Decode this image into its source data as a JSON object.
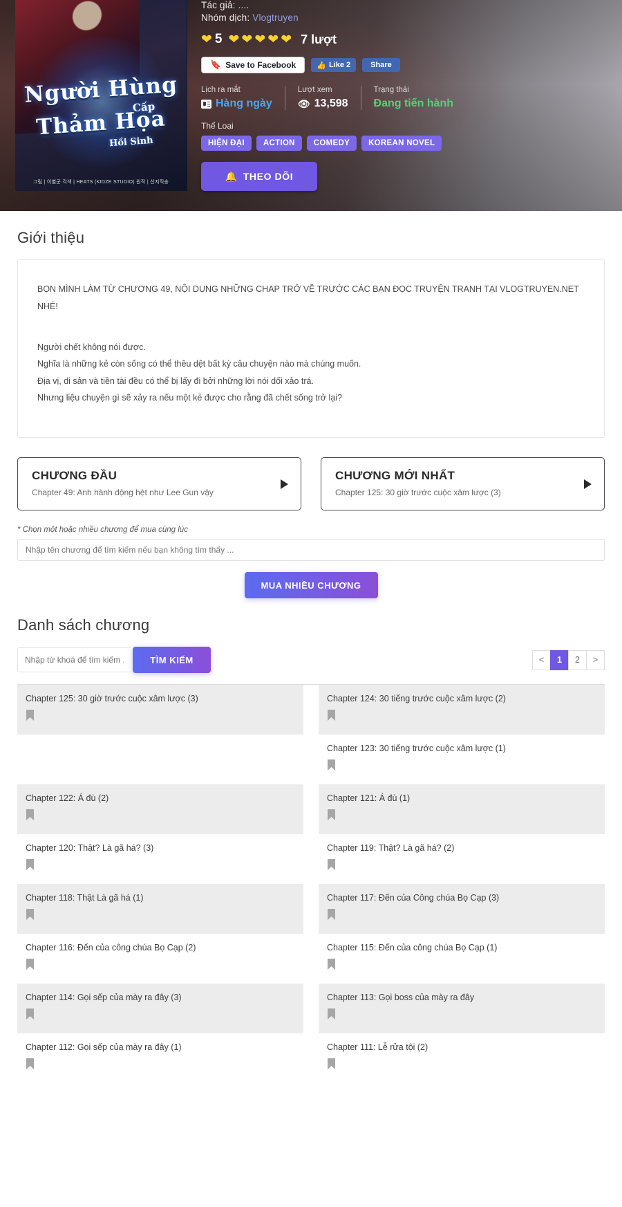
{
  "hero": {
    "cover": {
      "title_line1": "Người Hùng",
      "title_line2": "Thảm Họa",
      "title_small": "Cấp",
      "title_small2": "Hồi Sinh",
      "credits": "그림 | 이별군    각색 | HEATS (KIDZE STUDIO)    원작 | 산지직송"
    },
    "author_label": "Tác giả: ",
    "author_value": "....",
    "team_label": "Nhóm dịch: ",
    "team_value": "Vlogtruyen",
    "rating_value": "5",
    "rating_count": "7 lượt",
    "hearts_before": 1,
    "hearts_after": 5,
    "social": {
      "save_label": "Save to Facebook",
      "like_label": "Like 2",
      "share_label": "Share"
    },
    "stats": [
      {
        "caption": "Lịch ra mắt",
        "value": "Hàng ngày",
        "icon": "calendar-icon",
        "color": "blue"
      },
      {
        "caption": "Lượt xem",
        "value": "13,598",
        "icon": "eye-icon",
        "color": "white"
      },
      {
        "caption": "Trạng thái",
        "value": "Đang tiến hành",
        "icon": "",
        "color": "green"
      }
    ],
    "genre_caption": "Thể Loại",
    "genres": [
      "HIỆN ĐẠI",
      "ACTION",
      "COMEDY",
      "KOREAN NOVEL"
    ],
    "follow_label": "THEO DÕI",
    "follow_icon": "bell-icon"
  },
  "intro": {
    "heading": "Giới thiệu",
    "notice": "BỌN MÌNH LÀM TỪ CHƯƠNG 49, NỘI DUNG NHỮNG CHAP TRỞ VỀ TRƯỚC CÁC BẠN ĐỌC TRUYỆN TRANH TẠI VLOGTRUYEN.NET NHÉ!",
    "lines": [
      "Người chết không nói được.",
      "Nghĩa là những kẻ còn sống có thể thêu dệt bất kỳ câu chuyện nào mà chúng muốn.",
      "Địa vị, di sản và tiền tài đều có thể bị lấy đi bởi những lời nói dối xảo trá.",
      "Nhưng liệu chuyện gì sẽ xảy ra nếu một kẻ được cho rằng đã chết sống trở lại?"
    ]
  },
  "chapter_nav": {
    "first": {
      "title": "CHƯƠNG ĐẦU",
      "subtitle": "Chapter 49: Anh hành động hệt như Lee Gun vậy"
    },
    "latest": {
      "title": "CHƯƠNG MỚI NHẤT",
      "subtitle": "Chapter 125: 30 giờ trước cuộc xâm lược (3)"
    }
  },
  "buy": {
    "hint": "* Chọn một hoặc nhiều chương để mua cùng lúc",
    "input_placeholder": "Nhập tên chương để tìm kiếm nếu bạn không tìm thấy ...",
    "input_value": "",
    "button_label": "MUA NHIỀU CHƯƠNG"
  },
  "chapter_list": {
    "heading": "Danh sách chương",
    "search_placeholder": "Nhập từ khoá để tìm kiếm ...",
    "search_value": "",
    "search_button": "TÌM KIẾM",
    "pagination": {
      "prev": "<",
      "next": ">",
      "pages": [
        "1",
        "2"
      ],
      "active": "1"
    },
    "bookmark_icon": "bookmark-icon",
    "rows": [
      [
        {
          "name": "Chapter 125: 30 giờ trước cuộc xâm lược (3)",
          "shaded": true
        },
        {
          "name": "Chapter 124: 30 tiếng trước cuộc xâm lược (2)",
          "shaded": true
        }
      ],
      [
        {
          "name": "",
          "shaded": false,
          "empty": true
        },
        {
          "name": "Chapter 123: 30 tiếng trước cuộc xâm lược (1)",
          "shaded": false
        }
      ],
      [
        {
          "name": "Chapter 122: Á đù (2)",
          "shaded": true
        },
        {
          "name": "Chapter 121: Á đù (1)",
          "shaded": true
        }
      ],
      [
        {
          "name": "Chapter 120: Thật? Là gã há? (3)",
          "shaded": false
        },
        {
          "name": "Chapter 119: Thật? Là gã há? (2)",
          "shaded": false
        }
      ],
      [
        {
          "name": "Chapter 118: Thật Là gã há (1)",
          "shaded": true
        },
        {
          "name": "Chapter 117: Đến của Công chúa Bọ Cạp (3)",
          "shaded": true
        }
      ],
      [
        {
          "name": "Chapter 116: Đến của công chúa Bọ Cạp (2)",
          "shaded": false
        },
        {
          "name": "Chapter 115: Đến của công chúa Bọ Cạp (1)",
          "shaded": false
        }
      ],
      [
        {
          "name": "Chapter 114: Gọi sếp của mày ra đây (3)",
          "shaded": true
        },
        {
          "name": "Chapter 113: Gọi boss của mày ra đây",
          "shaded": true
        }
      ],
      [
        {
          "name": "Chapter 112: Gọi sếp của mày ra đây (1)",
          "shaded": false
        },
        {
          "name": "Chapter 111: Lễ rửa tội (2)",
          "shaded": false
        }
      ]
    ]
  },
  "colors": {
    "accent": "#7158e2",
    "genre": "#7b68e8",
    "status_green": "#56d07a",
    "link_blue": "#45a8f0",
    "heart": "#f5d133",
    "facebook": "#4267b2"
  }
}
